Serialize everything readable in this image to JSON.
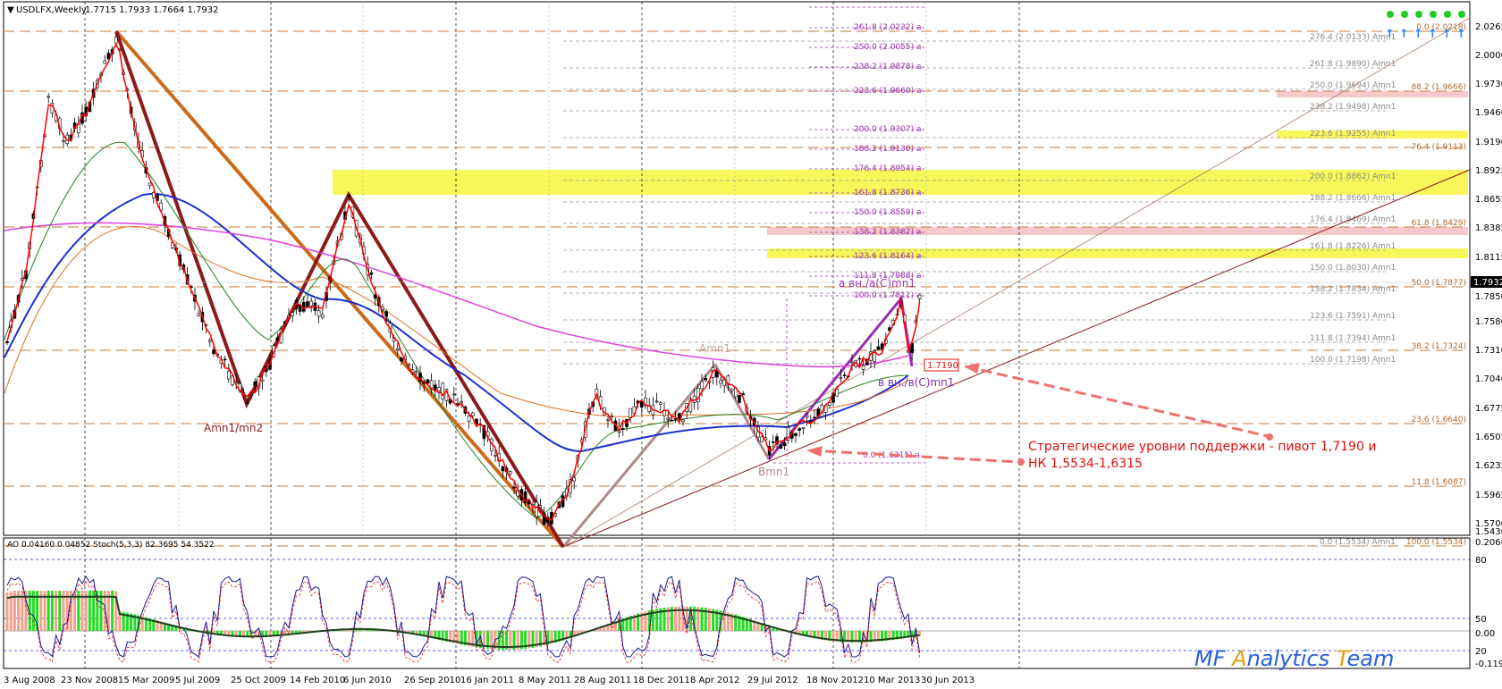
{
  "header": {
    "symbol_line": "USDLFX,Weekly",
    "ohlc": "1.7715 1.7933 1.7664 1.7932"
  },
  "osc_header": "AO 0.04160 0.04852  Stoch(5,3,3) 82.3695 54.3522",
  "watermark": {
    "prefix": "MF ",
    "a": "A",
    "mid": "nalytics ",
    "t": "T",
    "end": "eam"
  },
  "price_axis": [
    "2.0265",
    "2.0000",
    "1.9730",
    "1.9460",
    "1.9190",
    "1.8925",
    "1.8655",
    "1.8385",
    "1.8115",
    "1.7850",
    "1.7580",
    "1.7310",
    "1.7040",
    "1.6775",
    "1.6505",
    "1.6235",
    "1.5965",
    "1.5700",
    "1.5430"
  ],
  "current_price": "1.7932",
  "osc_axis": [
    "0.20669",
    "80",
    "50",
    "20",
    "0.00",
    "-0.11909"
  ],
  "time_axis": [
    "3 Aug 2008",
    "23 Nov 2008",
    "15 Mar 2009",
    "5 Jul 2009",
    "25 Oct 2009",
    "14 Feb 2010",
    "6 Jun 2010",
    "26 Sep 2010",
    "16 Jan 2011",
    "8 May 2011",
    "28 Aug 2011",
    "18 Dec 2011",
    "8 Apr 2012",
    "29 Jul 2012",
    "18 Nov 2012",
    "10 Mar 2013",
    "30 Jun 2013"
  ],
  "fib_a": [
    "261.8 (2.0232) a",
    "250.0 (2.0055) a",
    "238.2 (1.9878) a",
    "223.6 (1.9660) a",
    "200.0 (1.9307) a",
    "188.2 (1.9130) a",
    "176.4 (1.8954) a",
    "161.8 (1.8736) a",
    "150.0 (1.8559) a",
    "138.2 (1.8382) a",
    "123.6 (1.8164) a",
    "111.8 (1.7988) a",
    "100.0 (1.7811) a",
    "0.0 (1.6315) a"
  ],
  "fib_amn1": [
    "276.4 (2.0133) Amn1",
    "261.8 (1.9890) Amn1",
    "250.0 (1.9694) Amn1",
    "238.2 (1.9498) Amn1",
    "223.6 (1.9255) Amn1",
    "200.0 (1.8862) Amn1",
    "188.2 (1.8666) Amn1",
    "176.4 (1.8469) Amn1",
    "161.8 (1.8226) Amn1",
    "150.0 (1.8030) Amn1",
    "138.2 (1.7834) Amn1",
    "123.6 (1.7591) Amn1",
    "111.8 (1.7394) Amn1",
    "100.0 (1.7198) Amn1",
    "0.0 (1.5534) Amn1"
  ],
  "fib_right": [
    "0.0 (2.0218)",
    "88.2 (1.9666)",
    "76.4 (1.9113)",
    "61.8 (1.8429)",
    "50.0 (1.7877)",
    "38.2 (1.7324)",
    "23.6 (1.6640)",
    "11.8 (1.6087)",
    "100.0 (1.5534)"
  ],
  "pivot_box": "1.7190",
  "wave_labels": {
    "amn1_mn2": "Amn1/mn2",
    "amn1": "Amn1",
    "bmn1": "Bmn1",
    "a_label": "а вн./а(С)mn1",
    "b_label": "в вн./в(С)mn1"
  },
  "annotation": {
    "line1": "Стратегические уровни поддержки - пивот 1,7190 и",
    "line2": "НК 1,5534-1,6315"
  },
  "colors": {
    "yellow_zone": "#f7f75a",
    "pink_zone": "#f5c9c9",
    "annotation": "#e01010",
    "fib_purple": "#9a2fb0"
  }
}
